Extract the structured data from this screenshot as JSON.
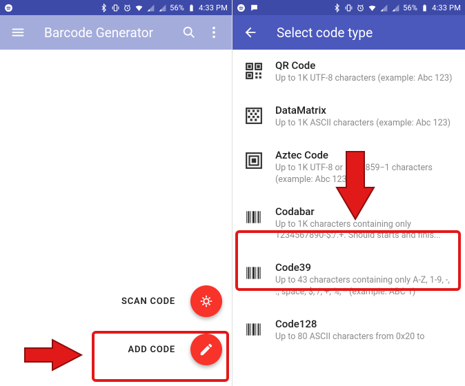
{
  "status": {
    "battery_text": "56%",
    "time_text": "4:33 PM"
  },
  "left": {
    "app_title": "Barcode Generator",
    "scan_label": "SCAN CODE",
    "add_label": "ADD CODE"
  },
  "right": {
    "app_title": "Select code type",
    "items": [
      {
        "title": "QR Code",
        "desc": "Up to 1K UTF-8 characters (example: Abc 123)",
        "icon": "qr"
      },
      {
        "title": "DataMatrix",
        "desc": "Up to 1K ASCII characters (example: Abc 123)",
        "icon": "datamatrix"
      },
      {
        "title": "Aztec Code",
        "desc": "Up to 1K UTF-8 or ISO 8859−1 characters (example: Abc 123)",
        "icon": "aztec"
      },
      {
        "title": "Codabar",
        "desc": "Up to 1K characters containing only 1234567890-$:/.+. Should starts and finis...",
        "icon": "barcode"
      },
      {
        "title": "Code39",
        "desc": "Up to 43 characters containing only A-Z, 1-9, -, ., space, $, /, +, %, * (example: ABC 1)",
        "icon": "barcode"
      },
      {
        "title": "Code128",
        "desc": "Up to 80 ASCII characters from 0x20 to",
        "icon": "barcode"
      }
    ]
  }
}
